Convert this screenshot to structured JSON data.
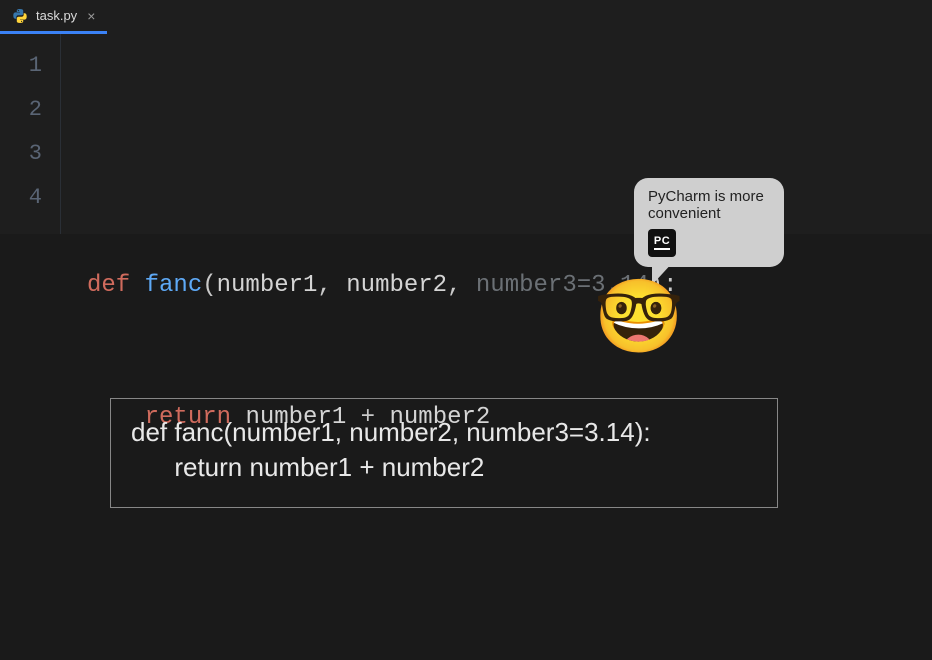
{
  "tab": {
    "filename": "task.py",
    "close_glyph": "×"
  },
  "gutter": {
    "lines": [
      "1",
      "2",
      "3",
      "4"
    ]
  },
  "code": {
    "l1": "",
    "l2": {
      "kw_def": "def ",
      "func": "fanc",
      "open": "(",
      "p1": "number1",
      "c1": ", ",
      "p2": "number2",
      "c2": ", ",
      "p3": "number3",
      "eq": "=",
      "dv": "3.14",
      "close": "):"
    },
    "l3": {
      "indent": "    ",
      "kw_return": "return ",
      "e1": "number1",
      "op": " + ",
      "e2": "number2"
    },
    "l4": ""
  },
  "bubble": {
    "text": "PyCharm is more convenient",
    "logo_text": "PC"
  },
  "emoji": "🤓",
  "plainbox": {
    "line1": "def fanc(number1, number2, number3=3.14):",
    "line2": "      return number1 + number2"
  }
}
